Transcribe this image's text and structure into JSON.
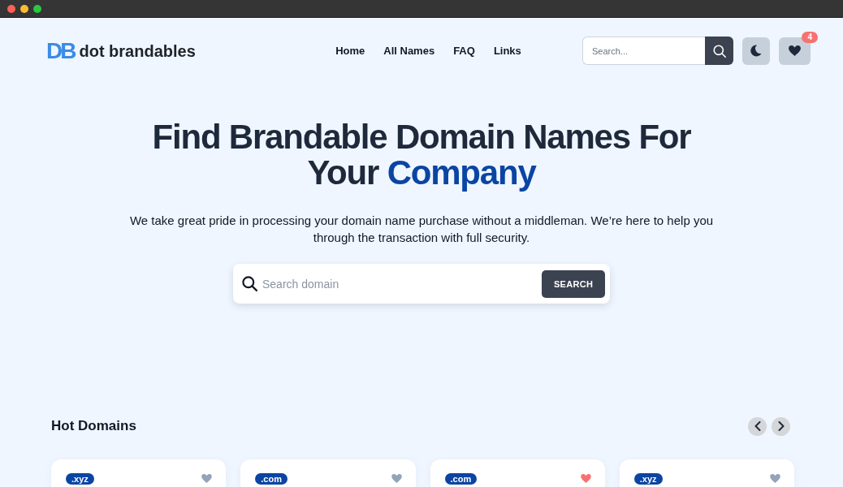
{
  "header": {
    "logo_mark": "DB",
    "logo_text": "dot brandables",
    "nav": [
      "Home",
      "All Names",
      "FAQ",
      "Links"
    ],
    "search": {
      "placeholder": "Search..."
    },
    "favorites_count": "4"
  },
  "hero": {
    "title": "Find Brandable Domain Names For Your",
    "title_highlight": "Company",
    "subtitle": "We take great pride in processing your domain name purchase without a middleman. We’re here to help you through the transaction with full security.",
    "search": {
      "placeholder": "Search domain",
      "button": "SEARCH"
    }
  },
  "hot_domains": {
    "title": "Hot Domains",
    "cards": [
      {
        "extension": ".xyz",
        "favorited": false
      },
      {
        "extension": ".com",
        "favorited": false
      },
      {
        "extension": ".com",
        "favorited": true
      },
      {
        "extension": ".xyz",
        "favorited": false
      }
    ]
  }
}
